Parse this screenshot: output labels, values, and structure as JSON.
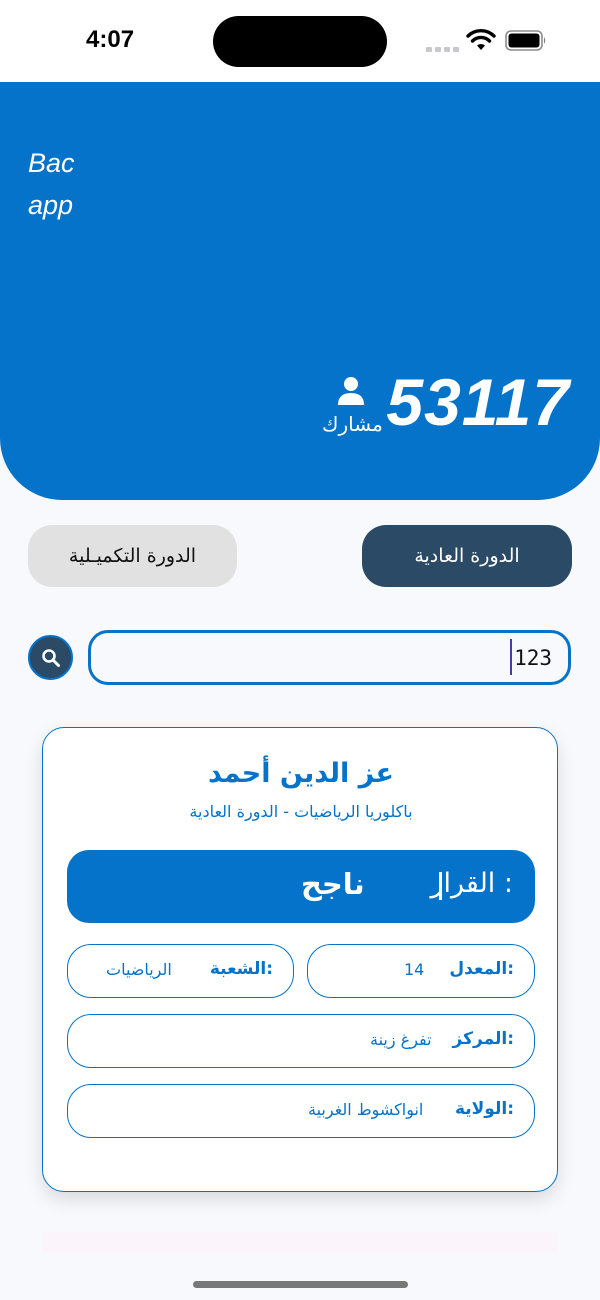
{
  "status": {
    "time": "4:07"
  },
  "header": {
    "app_title_line1": "Bac",
    "app_title_line2": "app",
    "participants_count": "53117",
    "participants_label": "مشارك",
    "participant_icon": "person-icon"
  },
  "sessions": {
    "regular_label": "الدورة العادية",
    "complementary_label": "الدورة التكميـلية",
    "selected": "regular"
  },
  "search": {
    "value": "123",
    "icon": "search-icon"
  },
  "result": {
    "name": "عز الدين  أحمد",
    "subtitle": "باكلوريا الرياضيات - الدورة العادية",
    "decision_label": "القرار :",
    "decision_value": "ناجح",
    "average_label": "المعدل:",
    "average_value": "14",
    "branch_label": "الشعبة:",
    "branch_value": "الرياضيات",
    "center_label": "المركز:",
    "center_value": "تفرغ زينة",
    "state_label": "الولاية:",
    "state_value": "انواكشوط الغربية"
  },
  "colors": {
    "primary": "#0473c9",
    "dark_button": "#2b4a66",
    "light_button": "#e1e1e1"
  }
}
